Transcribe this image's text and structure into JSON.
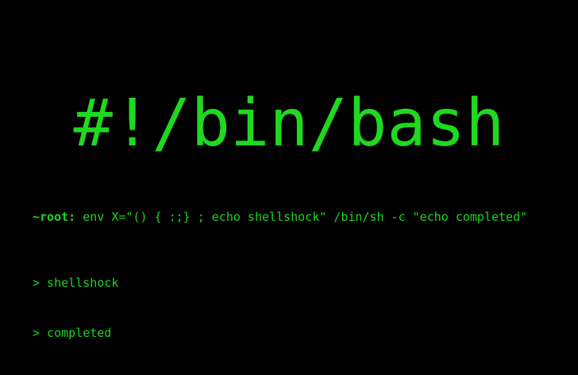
{
  "terminal": {
    "shebang": "#!/bin/bash",
    "prompt": "~root:",
    "command": " env X=\"() { :;} ; echo shellshock\" /bin/sh -c \"echo completed\"",
    "output": [
      "> shellshock",
      "> completed"
    ]
  },
  "colors": {
    "background": "#000000",
    "text": "#1ed41e"
  }
}
